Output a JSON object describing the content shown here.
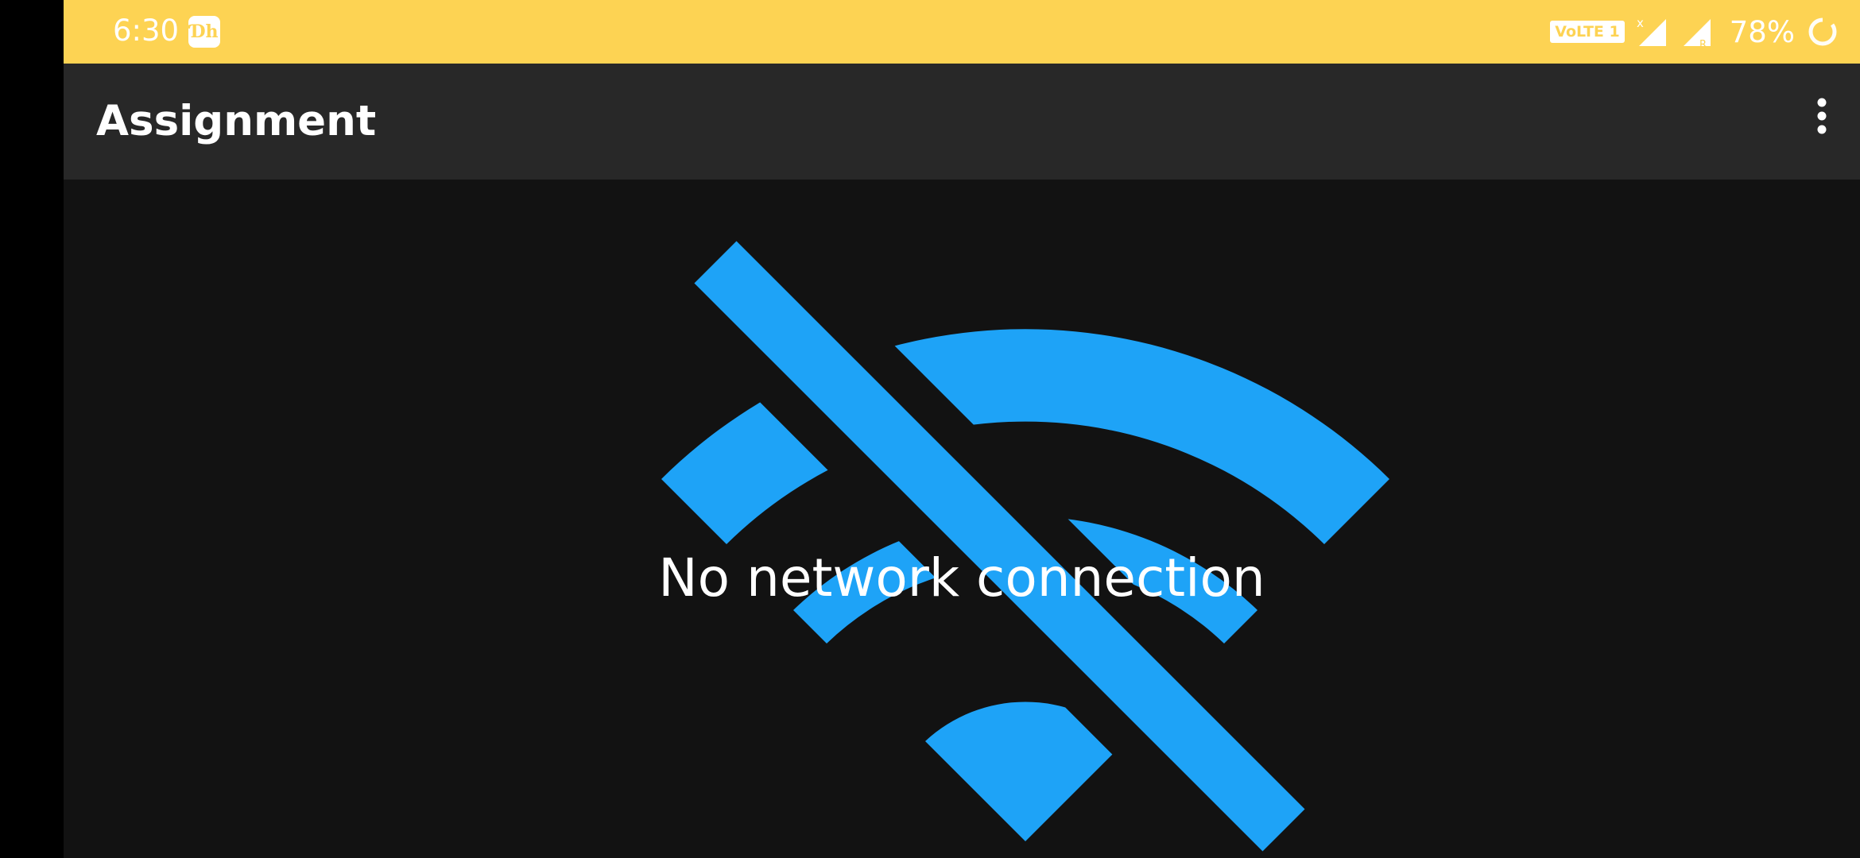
{
  "status_bar": {
    "time": "6:30",
    "app_icon": "disney-hotstar-icon",
    "volte_label": "VoLTE 1",
    "signal_1_icon": "signal-no-data-icon",
    "signal_2_icon": "signal-roaming-icon",
    "battery_percent": "78%",
    "battery_icon": "battery-ring-icon",
    "background_color": "#FDD353"
  },
  "app_bar": {
    "title": "Assignment",
    "overflow_icon": "more-vert-icon",
    "background_color": "#282828"
  },
  "main": {
    "icon": "wifi-off-icon",
    "icon_color": "#1EA3F7",
    "message": "No network connection",
    "background_color": "#121212"
  }
}
